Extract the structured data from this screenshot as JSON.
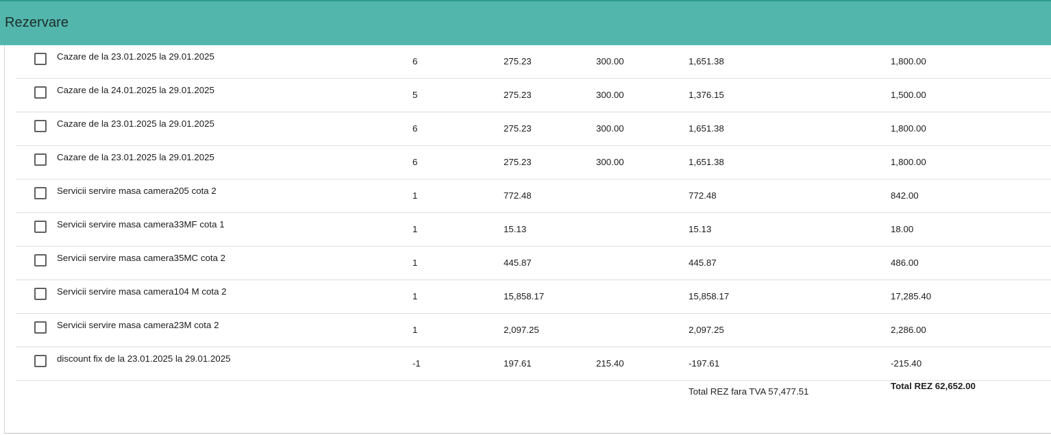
{
  "header": {
    "title": "Rezervare"
  },
  "rows": [
    {
      "description": "Cazare de la 23.01.2025 la 29.01.2025",
      "qty": "6",
      "price": "275.23",
      "price_vat": "300.00",
      "value": "1,651.38",
      "total": "1,800.00"
    },
    {
      "description": "Cazare de la 24.01.2025 la 29.01.2025",
      "qty": "5",
      "price": "275.23",
      "price_vat": "300.00",
      "value": "1,376.15",
      "total": "1,500.00"
    },
    {
      "description": "Cazare de la 23.01.2025 la 29.01.2025",
      "qty": "6",
      "price": "275.23",
      "price_vat": "300.00",
      "value": "1,651.38",
      "total": "1,800.00"
    },
    {
      "description": "Cazare de la 23.01.2025 la 29.01.2025",
      "qty": "6",
      "price": "275.23",
      "price_vat": "300.00",
      "value": "1,651.38",
      "total": "1,800.00"
    },
    {
      "description": "Servicii servire masa camera205 cota 2",
      "qty": "1",
      "price": "772.48",
      "price_vat": "",
      "value": "772.48",
      "total": "842.00"
    },
    {
      "description": "Servicii servire masa camera33MF cota 1",
      "qty": "1",
      "price": "15.13",
      "price_vat": "",
      "value": "15.13",
      "total": "18.00"
    },
    {
      "description": "Servicii servire masa camera35MC cota 2",
      "qty": "1",
      "price": "445.87",
      "price_vat": "",
      "value": "445.87",
      "total": "486.00"
    },
    {
      "description": "Servicii servire masa camera104 M cota 2",
      "qty": "1",
      "price": "15,858.17",
      "price_vat": "",
      "value": "15,858.17",
      "total": "17,285.40"
    },
    {
      "description": "Servicii servire masa camera23M cota 2",
      "qty": "1",
      "price": "2,097.25",
      "price_vat": "",
      "value": "2,097.25",
      "total": "2,286.00"
    },
    {
      "description": "discount fix de la 23.01.2025 la 29.01.2025",
      "qty": "-1",
      "price": "197.61",
      "price_vat": "215.40",
      "value": "-197.61",
      "total": "-215.40"
    }
  ],
  "totals": {
    "without_vat": "Total REZ fara TVA 57,477.51",
    "total": "Total REZ 62,652.00"
  },
  "colors": {
    "header_bg": "#52b6ac",
    "header_border": "#2e9c8f"
  }
}
